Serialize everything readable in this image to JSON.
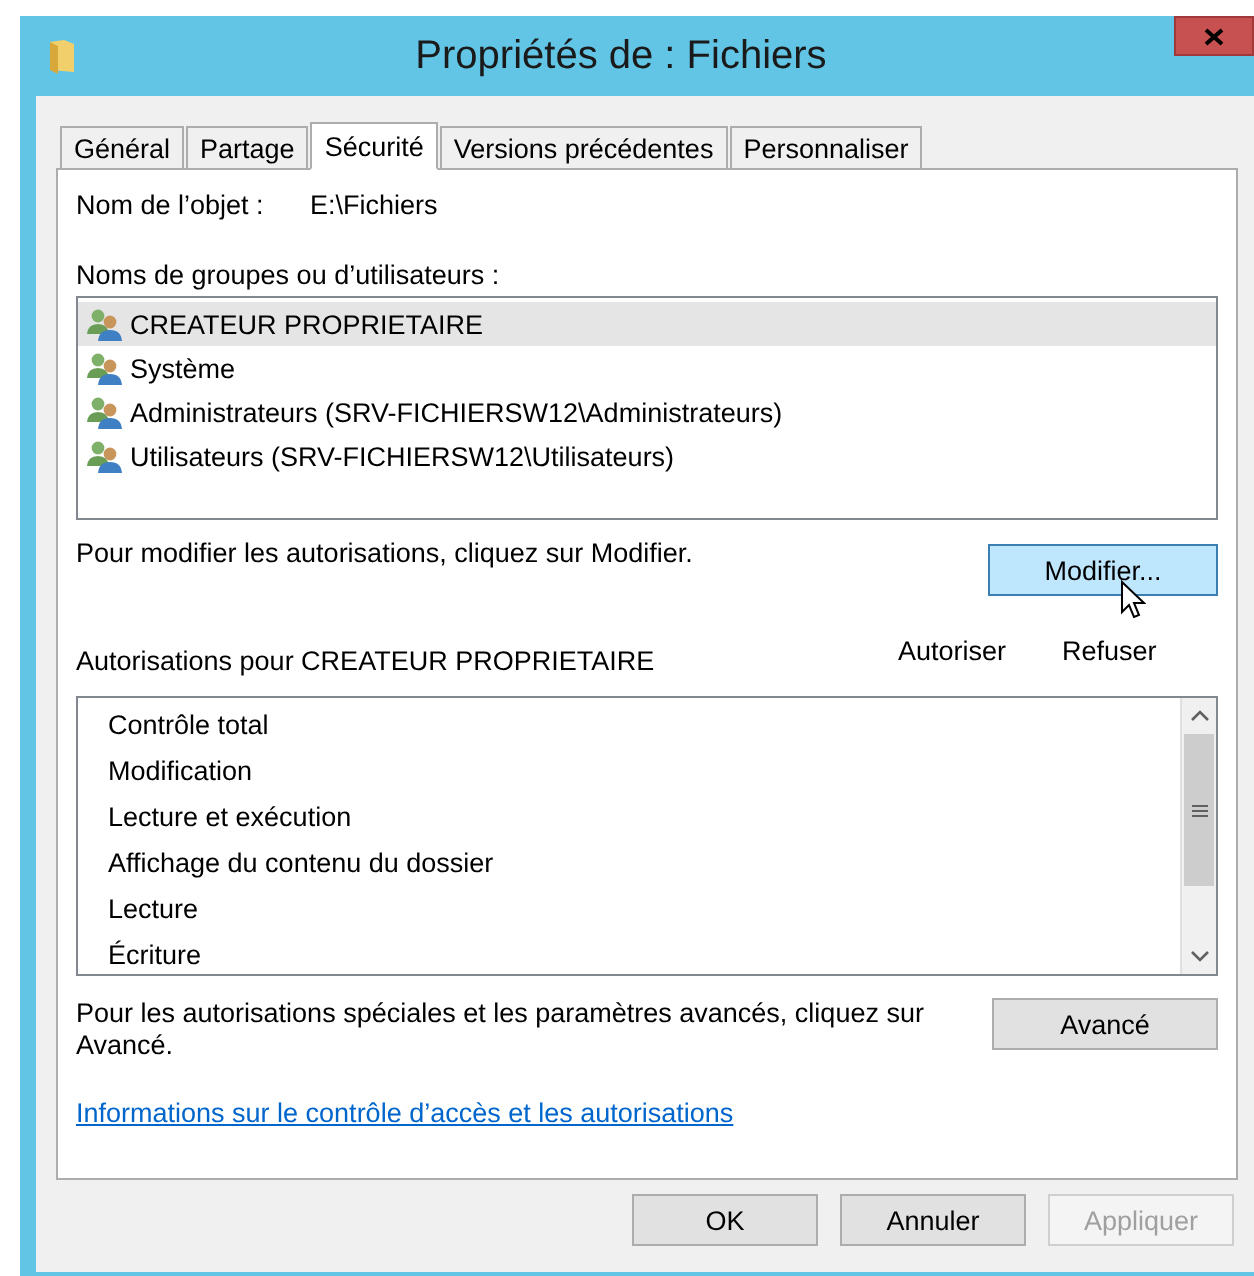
{
  "window": {
    "title": "Propriétés de : Fichiers"
  },
  "tabs": [
    {
      "label": "Général",
      "selected": false
    },
    {
      "label": "Partage",
      "selected": false
    },
    {
      "label": "Sécurité",
      "selected": true
    },
    {
      "label": "Versions précédentes",
      "selected": false
    },
    {
      "label": "Personnaliser",
      "selected": false
    }
  ],
  "object_name": {
    "label": "Nom de l’objet :",
    "value": "E:\\Fichiers"
  },
  "groups": {
    "label": "Noms de groupes ou d’utilisateurs :",
    "items": [
      {
        "name": "CREATEUR PROPRIETAIRE",
        "selected": true
      },
      {
        "name": "Système",
        "selected": false
      },
      {
        "name": "Administrateurs (SRV-FICHIERSW12\\Administrateurs)",
        "selected": false
      },
      {
        "name": "Utilisateurs (SRV-FICHIERSW12\\Utilisateurs)",
        "selected": false
      }
    ]
  },
  "edit_hint": "Pour modifier les autorisations, cliquez sur Modifier.",
  "edit_button": {
    "label": "Modifier...",
    "hovered": true
  },
  "permissions": {
    "title": "Autorisations pour CREATEUR PROPRIETAIRE",
    "columns": [
      "Autoriser",
      "Refuser"
    ],
    "items": [
      {
        "name": "Contrôle total"
      },
      {
        "name": "Modification"
      },
      {
        "name": "Lecture et exécution"
      },
      {
        "name": "Affichage du contenu du dossier"
      },
      {
        "name": "Lecture"
      },
      {
        "name": "Écriture"
      }
    ]
  },
  "advanced_hint": "Pour les autorisations spéciales et les paramètres avancés, cliquez sur Avancé.",
  "advanced_button": {
    "label": "Avancé"
  },
  "help_link": "Informations sur le contrôle d’accès et les autorisations",
  "buttons": [
    {
      "label": "OK",
      "disabled": false
    },
    {
      "label": "Annuler",
      "disabled": false
    },
    {
      "label": "Appliquer",
      "disabled": true
    }
  ]
}
